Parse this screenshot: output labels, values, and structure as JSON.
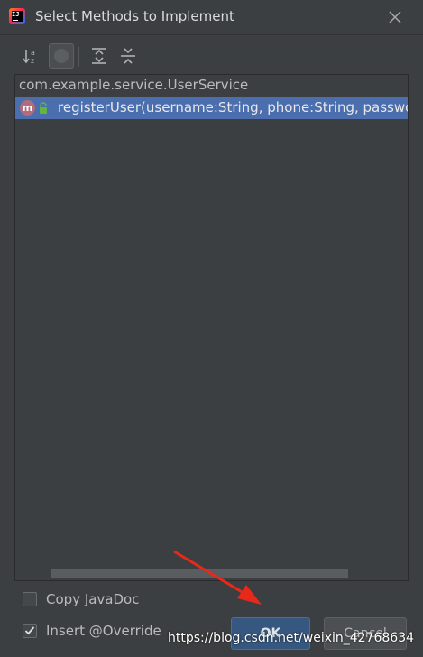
{
  "window": {
    "title": "Select Methods to Implement"
  },
  "toolbar": {
    "buttons": [
      {
        "icon": "sort-alphabetically-icon"
      },
      {
        "icon": "show-classes-icon"
      },
      {
        "icon": "expand-all-icon"
      },
      {
        "icon": "collapse-all-icon"
      }
    ]
  },
  "tree": {
    "root": "com.example.service.UserService",
    "items": [
      {
        "text": "registerUser(username:String, phone:String, passwo",
        "icon": "method-icon",
        "visibility": "public-lock-icon",
        "selected": true
      }
    ]
  },
  "options": {
    "copy_javadoc": {
      "label": "Copy JavaDoc",
      "checked": false
    },
    "insert_override": {
      "label": "Insert @Override",
      "checked": true
    }
  },
  "buttons": {
    "ok": "OK",
    "cancel": "Cancel"
  },
  "watermark": "https://blog.csdn.net/weixin_42768634",
  "colors": {
    "selection": "#4b6eaf",
    "background": "#3c3f41",
    "ok_button": "#365880",
    "arrow": "#e8281a"
  }
}
